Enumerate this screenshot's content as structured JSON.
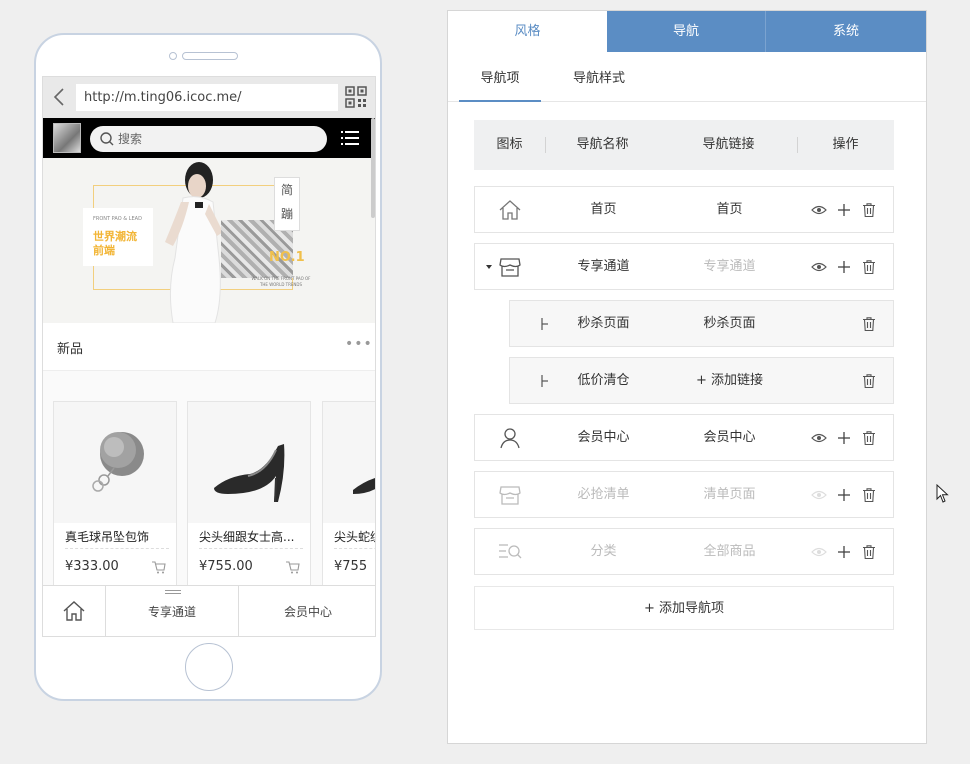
{
  "preview": {
    "url": "http://m.ting06.icoc.me/",
    "search_placeholder": "搜索",
    "banner": {
      "small_text": "FRONT PAO & LEAD",
      "title_line1": "世界潮流",
      "title_line2": "前端",
      "tag1": "简",
      "tag2": "蹦",
      "no1": "NO.1",
      "sub_text": "WALK ON THE FRONT PAO OF THE WORLD TRENDS"
    },
    "section_title": "新品",
    "more": "•••",
    "products": [
      {
        "name": "真毛球吊坠包饰",
        "price": "¥333.00"
      },
      {
        "name": "尖头细跟女士高...",
        "price": "¥755.00"
      },
      {
        "name": "尖头蛇纹",
        "price": "¥755"
      }
    ],
    "bottom_nav": [
      {
        "label": "首页",
        "icon": "home-icon"
      },
      {
        "label": "专享通道"
      },
      {
        "label": "会员中心"
      }
    ]
  },
  "panel": {
    "tabs": [
      {
        "label": "风格",
        "active": true
      },
      {
        "label": "导航",
        "active": false
      },
      {
        "label": "系统",
        "active": false
      }
    ],
    "subtabs": [
      {
        "label": "导航项",
        "active": true
      },
      {
        "label": "导航样式",
        "active": false
      }
    ],
    "table_headers": [
      "图标",
      "导航名称",
      "导航链接",
      "操作"
    ],
    "rows": [
      {
        "icon": "home-icon",
        "name": "首页",
        "link": "首页",
        "level": 0,
        "visible": true
      },
      {
        "icon": "store-icon",
        "name": "专享通道",
        "link": "专享通道",
        "level": 0,
        "visible": true,
        "expanded": true
      },
      {
        "icon": "child-branch-icon",
        "name": "秒杀页面",
        "link": "秒杀页面",
        "level": 1
      },
      {
        "icon": "child-branch-icon",
        "name": "低价清仓",
        "link": "+ 添加链接",
        "level": 1
      },
      {
        "icon": "user-icon",
        "name": "会员中心",
        "link": "会员中心",
        "level": 0,
        "visible": true
      },
      {
        "icon": "store-icon",
        "name": "必抢清单",
        "link": "清单页面",
        "level": 0,
        "visible": false
      },
      {
        "icon": "list-search-icon",
        "name": "分类",
        "link": "全部商品",
        "level": 0,
        "visible": false
      }
    ],
    "add_nav_label": "+ 添加导航项",
    "accent_color": "#5b8dc4"
  }
}
